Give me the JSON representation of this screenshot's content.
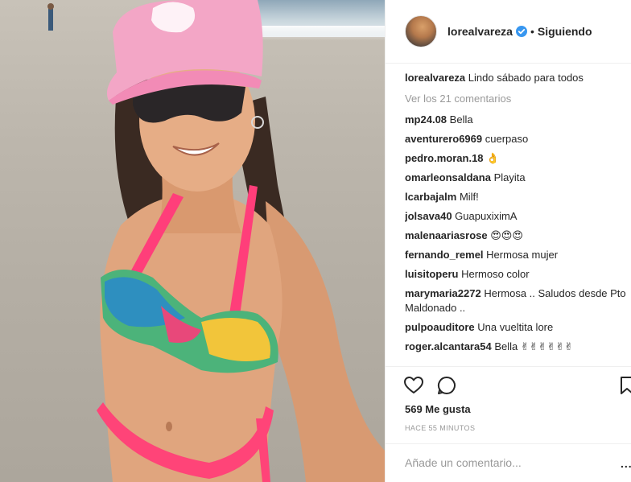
{
  "post": {
    "username": "lorealvareza",
    "follow_label": "Siguiendo",
    "separator": "•",
    "verified": true,
    "caption": "Lindo sábado para todos",
    "view_comments": "Ver los 21 comentarios",
    "comments": [
      {
        "user": "mp24.08",
        "text": "Bella"
      },
      {
        "user": "aventurero6969",
        "text": "cuerpaso"
      },
      {
        "user": "pedro.moran.18",
        "text": "👌"
      },
      {
        "user": "omarleonsaldana",
        "text": "Playita"
      },
      {
        "user": "lcarbajalm",
        "text": "Milf!"
      },
      {
        "user": "jolsava40",
        "text": "GuapuxiximA"
      },
      {
        "user": "malenaariasrose",
        "text": "😍😍😍"
      },
      {
        "user": "fernando_remel",
        "text": "Hermosa mujer"
      },
      {
        "user": "luisitoperu",
        "text": "Hermoso color"
      },
      {
        "user": "marymaria2272",
        "text": "Hermosa .. Saludos desde Pto Maldonado .."
      },
      {
        "user": "pulpoauditore",
        "text": "Una vueltita lore"
      },
      {
        "user": "roger.alcantara54",
        "text": "Bella ✌✌✌✌✌✌"
      }
    ],
    "likes": "569 Me gusta",
    "timestamp": "HACE 55 MINUTOS",
    "add_comment_placeholder": "Añade un comentario...",
    "options": "..."
  },
  "colors": {
    "text": "#262626",
    "muted": "#999999",
    "verified": "#3897f0",
    "border": "#efefef"
  },
  "icons": [
    "heart-icon",
    "comment-icon",
    "bookmark-icon",
    "verified-badge-icon"
  ]
}
